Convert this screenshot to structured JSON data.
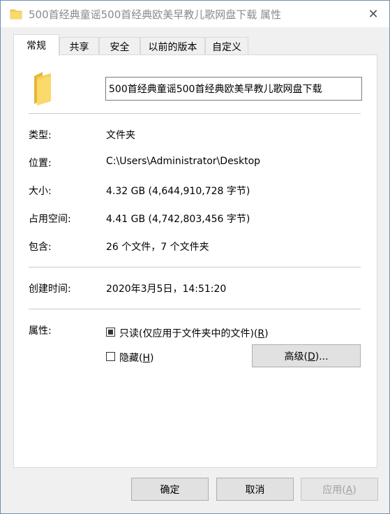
{
  "window": {
    "title": "500首经典童谣500首经典欧美早教儿歌网盘下载 属性",
    "close_glyph": "✕"
  },
  "tabs": [
    {
      "label": "常规",
      "active": true
    },
    {
      "label": "共享",
      "active": false
    },
    {
      "label": "安全",
      "active": false
    },
    {
      "label": "以前的版本",
      "active": false
    },
    {
      "label": "自定义",
      "active": false
    }
  ],
  "general": {
    "folder_name": "500首经典童谣500首经典欧美早教儿歌网盘下载",
    "type_label": "类型:",
    "type_value": "文件夹",
    "location_label": "位置:",
    "location_value": "C:\\Users\\Administrator\\Desktop",
    "size_label": "大小:",
    "size_value": "4.32 GB (4,644,910,728 字节)",
    "disk_size_label": "占用空间:",
    "disk_size_value": "4.41 GB (4,742,803,456 字节)",
    "contains_label": "包含:",
    "contains_value": "26 个文件，7 个文件夹",
    "created_label": "创建时间:",
    "created_value": "2020年3月5日，14:51:20",
    "attributes_label": "属性:",
    "readonly_label_main": "只读(仅应用于文件夹中的文件)(",
    "readonly_accel": "R",
    "readonly_close": ")",
    "readonly_state": "indeterminate",
    "hidden_label_main": "隐藏(",
    "hidden_accel": "H",
    "hidden_close": ")",
    "hidden_checked": false,
    "advanced_main": "高级(",
    "advanced_accel": "D",
    "advanced_close": ")..."
  },
  "footer": {
    "ok_label": "确定",
    "cancel_label": "取消",
    "apply_main": "应用(",
    "apply_accel": "A",
    "apply_close": ")"
  },
  "icons": {
    "title": "folder-icon",
    "large": "folder-icon",
    "close": "close-icon"
  },
  "colors": {
    "folder": "#f6cf57",
    "folder_dark": "#e8b637",
    "panel_bg": "#ffffff",
    "dialog_bg": "#f0f0f0"
  }
}
